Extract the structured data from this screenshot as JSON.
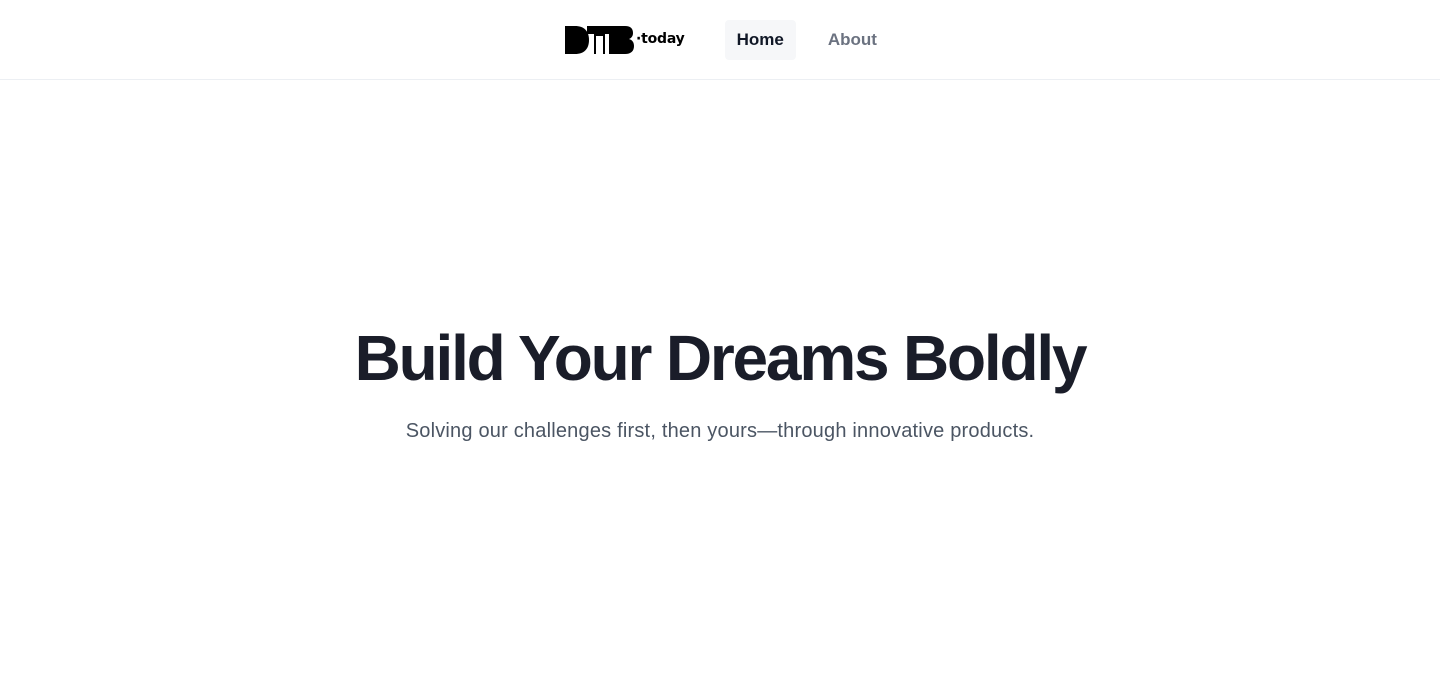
{
  "header": {
    "logo": {
      "mark_text": "DTB",
      "word": "·today"
    },
    "nav": [
      {
        "label": "Home",
        "active": true
      },
      {
        "label": "About",
        "active": false
      }
    ]
  },
  "hero": {
    "title": "Build Your Dreams Boldly",
    "subtitle": "Solving our challenges first, then yours—through innovative products."
  },
  "colors": {
    "title": "#1a1d29",
    "subtitle": "#4b5563",
    "nav_active_bg": "#f6f7f9",
    "nav_inactive": "#6b7280"
  }
}
